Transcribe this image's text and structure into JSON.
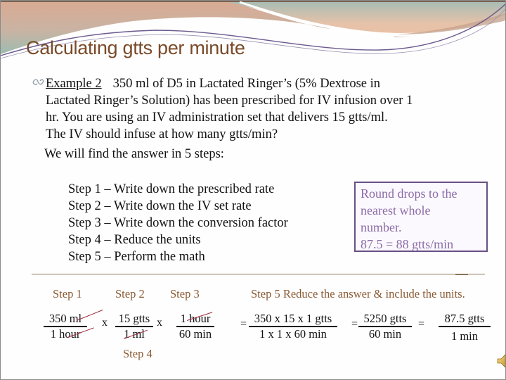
{
  "slide": {
    "title": "Calculating gtts per minute",
    "bullet_icon": "curly-bullet-icon",
    "example_label": "Example 2",
    "problem_lines": [
      "350 ml of D5 in Lactated Ringer’s (5% Dextrose in",
      "Lactated Ringer’s Solution) has been prescribed for IV infusion over 1",
      "hr.  You are using an IV administration set that delivers 15 gtts/ml.",
      "The IV should infuse at how many gtts/min?"
    ],
    "intro": "We will find the answer in 5 steps:",
    "steps": [
      "Step 1 – Write down the prescribed rate",
      "Step 2 – Write down the IV set rate",
      "Step 3 – Write down the conversion factor",
      "Step 4 – Reduce the units",
      "Step 5 – Perform the math"
    ],
    "round_box": [
      "Round drops to the",
      "nearest whole",
      "number.",
      "87.5 = 88 gtts/min"
    ],
    "calc": {
      "labels": {
        "step1": "Step 1",
        "step2": "Step 2",
        "step3": "Step 3",
        "step4": "Step 4",
        "step5": "Step 5   Reduce the answer & include the units."
      },
      "fractions": [
        {
          "num": "350 ml",
          "den": "1 hour"
        },
        {
          "num": "15 gtts",
          "den": "1 ml"
        },
        {
          "num": "1 hour",
          "den": "60  min"
        },
        {
          "num": "350 x 15 x 1 gtts",
          "den": "1 x 1 x 60    min"
        },
        {
          "num": "5250 gtts",
          "den": "60 min"
        },
        {
          "num": "87.5 gtts",
          "den": "1 min"
        }
      ],
      "operators": {
        "times": "x",
        "equals": "="
      }
    },
    "speaker_icon": "speaker-icon",
    "colors": {
      "title": "#7a4a28",
      "step_label": "#8b5a32",
      "box_border": "#6a4f86",
      "box_text": "#8b6aa8",
      "strike": "#9b2d3c"
    }
  }
}
